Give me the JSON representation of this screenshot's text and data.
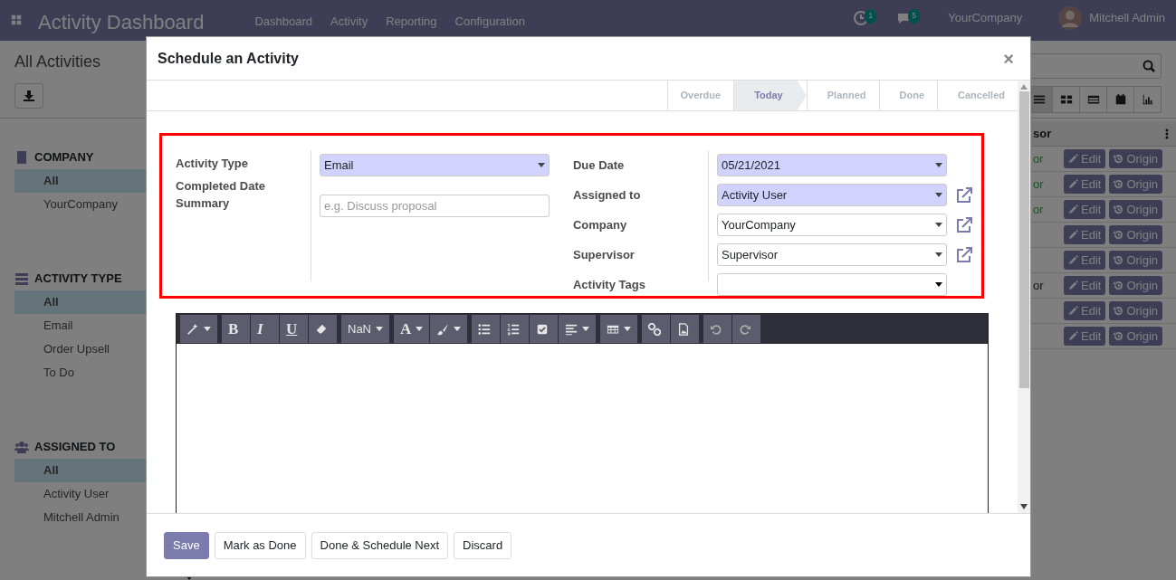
{
  "navbar": {
    "app_title": "Activity Dashboard",
    "menu": [
      "Dashboard",
      "Activity",
      "Reporting",
      "Configuration"
    ],
    "activity_badge": "1",
    "message_badge": "5",
    "company": "YourCompany",
    "user": "Mitchell Admin"
  },
  "control_panel": {
    "title": "All Activities"
  },
  "views": [
    {
      "kind": "list",
      "selected": true
    },
    {
      "kind": "kanban",
      "selected": false
    },
    {
      "kind": "grid",
      "selected": false
    },
    {
      "kind": "calendar",
      "selected": false
    },
    {
      "kind": "graph",
      "selected": false
    }
  ],
  "sidebar": [
    {
      "kind": "company",
      "title": "COMPANY",
      "items": [
        {
          "label": "All",
          "selected": true
        },
        {
          "label": "YourCompany",
          "selected": false
        }
      ]
    },
    {
      "kind": "activity_type",
      "title": "ACTIVITY TYPE",
      "items": [
        {
          "label": "All",
          "selected": true
        },
        {
          "label": "Email",
          "selected": false
        },
        {
          "label": "Order Upsell",
          "selected": false
        },
        {
          "label": "To Do",
          "selected": false
        }
      ]
    },
    {
      "kind": "assigned",
      "title": "ASSIGNED TO",
      "items": [
        {
          "label": "All",
          "selected": true
        },
        {
          "label": "Activity User",
          "selected": false
        },
        {
          "label": "Mitchell Admin",
          "selected": false
        }
      ]
    }
  ],
  "table": {
    "columns": [
      "sor"
    ],
    "rows": [
      {
        "column_1": "or",
        "color": "#145422",
        "edit": "Edit",
        "origin": "Origin"
      },
      {
        "column_1": "or",
        "color": "#145422",
        "edit": "Edit",
        "origin": "Origin"
      },
      {
        "column_1": "or",
        "color": "#145422",
        "edit": "Edit",
        "origin": "Origin"
      },
      {
        "edit": "Edit",
        "origin": "Origin"
      },
      {
        "edit": "Edit",
        "origin": "Origin"
      },
      {
        "column_1": "or",
        "color": "#101214",
        "edit": "Edit",
        "origin": "Origin"
      },
      {
        "edit": "Edit",
        "origin": "Origin"
      },
      {
        "edit": "Edit",
        "origin": "Origin"
      }
    ]
  },
  "dialog": {
    "title": "Schedule an Activity",
    "close": "×",
    "stages": [
      {
        "label": "Overdue",
        "selected": false
      },
      {
        "label": "Today",
        "selected": true
      },
      {
        "label": "Planned",
        "selected": false
      },
      {
        "label": "Done",
        "selected": false
      },
      {
        "label": "Cancelled",
        "selected": false
      }
    ],
    "fields_left": [
      {
        "label": "Activity Type",
        "kind": "select",
        "value": "Email",
        "required": true
      },
      {
        "label": "Completed Date",
        "kind": "none"
      },
      {
        "label": "Summary",
        "kind": "input",
        "placeholder": "e.g. Discuss proposal"
      }
    ],
    "fields_right": [
      {
        "label": "Due Date",
        "kind": "select",
        "value": "05/21/2021",
        "required": true,
        "external_link": false
      },
      {
        "label": "Assigned to",
        "kind": "select",
        "value": "Activity User",
        "required": true,
        "external_link": true
      },
      {
        "label": "Company",
        "kind": "select",
        "value": "YourCompany",
        "required": false,
        "external_link": true
      },
      {
        "label": "Supervisor",
        "kind": "select",
        "value": "Supervisor",
        "required": false,
        "external_link": true
      },
      {
        "label": "Activity Tags",
        "kind": "tags",
        "required": false,
        "external_link": false
      }
    ],
    "toolbar": [
      [
        {
          "kind": "magic",
          "caret": true
        }
      ],
      [
        {
          "kind": "bold",
          "label": "B"
        },
        {
          "kind": "italic",
          "label": "I"
        },
        {
          "kind": "underline",
          "label": "U"
        },
        {
          "kind": "eraser"
        }
      ],
      [
        {
          "kind": "font_size",
          "label": "NaN",
          "caret": true
        }
      ],
      [
        {
          "kind": "font_color",
          "label": "A",
          "caret": true
        },
        {
          "kind": "brush",
          "caret": true
        }
      ],
      [
        {
          "kind": "bullets"
        },
        {
          "kind": "numbers"
        },
        {
          "kind": "checklist"
        },
        {
          "kind": "align",
          "caret": true
        }
      ],
      [
        {
          "kind": "table",
          "caret": true
        }
      ],
      [
        {
          "kind": "link"
        },
        {
          "kind": "image"
        }
      ],
      [
        {
          "kind": "undo"
        },
        {
          "kind": "redo"
        }
      ]
    ],
    "buttons": [
      {
        "label": "Save",
        "primary": true
      },
      {
        "label": "Mark as Done",
        "primary": false
      },
      {
        "label": "Done & Schedule Next",
        "primary": false
      },
      {
        "label": "Discard",
        "primary": false
      }
    ]
  }
}
